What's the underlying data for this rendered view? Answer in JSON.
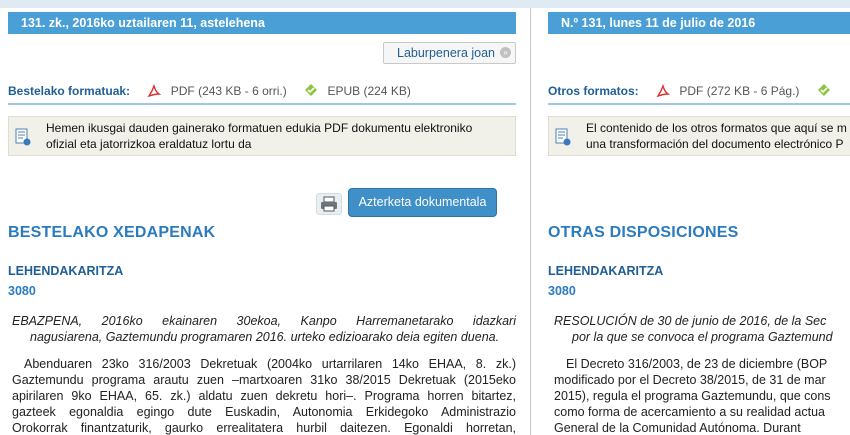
{
  "left": {
    "header": "131. zk., 2016ko uztailaren 11, astelehena",
    "jump_button": "Laburpenera joan",
    "formats_label": "Bestelako formatuak:",
    "pdf": "PDF (243 KB - 6 orri.)",
    "epub": "EPUB (224 KB)",
    "note_line1": "Hemen ikusgai dauden gainerako formatuen edukia PDF dokumentu elektroniko",
    "note_line2": "ofizial eta jatorrizkoa eraldatuz lortu da",
    "analyze_button": "Azterketa dokumentala",
    "section_title": "BESTELAKO XEDAPENAK",
    "organization": "LEHENDAKARITZA",
    "number": "3080",
    "resolution_lines": [
      "EBAZPENA, 2016ko ekainaren 30ekoa, Kanpo Harremanetarako idazkari",
      "nagusiarena, Gaztemundu programaren 2016. urteko edizioarako deia egiten duena."
    ],
    "body_lines": [
      "Abenduaren 23ko 316/2003 Dekretuak (2004ko urtarrilaren 14ko EHAA, 8. zk.)",
      "Gaztemundu programa arautu zuen –martxoaren 31ko 38/2015 Dekretuak (2015eko",
      "apirilaren 9ko EHAA, 65. zk.) aldatu zuen dekretu hori–. Programa horren bitartez,",
      "gazteek egonaldia egingo dute Euskadin, Autonomia Erkidegoko Administrazio",
      "Orokorrak finantzaturik, gaurko errealitatera hurbil daitezen. Egonaldi horretan,"
    ]
  },
  "right": {
    "header": "N.º 131, lunes 11 de julio de 2016",
    "formats_label": "Otros formatos:",
    "pdf": "PDF (272 KB - 6 Pág.)",
    "note_line1": "El contenido de los otros formatos que aquí se m",
    "note_line2": "una transformación del documento electrónico P",
    "section_title": "OTRAS DISPOSICIONES",
    "organization": "LEHENDAKARITZA",
    "number": "3080",
    "resolution_lines": [
      "RESOLUCIÓN de 30 de junio de 2016, de la Sec",
      "por la que se convoca el programa Gaztemund"
    ],
    "body_lines": [
      "El Decreto 316/2003, de 23 de diciembre (BOP",
      "modificado por el Decreto 38/2015, de 31 de mar",
      "2015), regula el programa Gaztemundu, que cons",
      "como forma de acercamiento a su realidad actua",
      "General de la Comunidad Autónoma. Durant"
    ]
  },
  "colors": {
    "header_blue": "#4a9fd6",
    "title_blue": "#2b7bbf",
    "note_bg": "#f1f0e9"
  }
}
